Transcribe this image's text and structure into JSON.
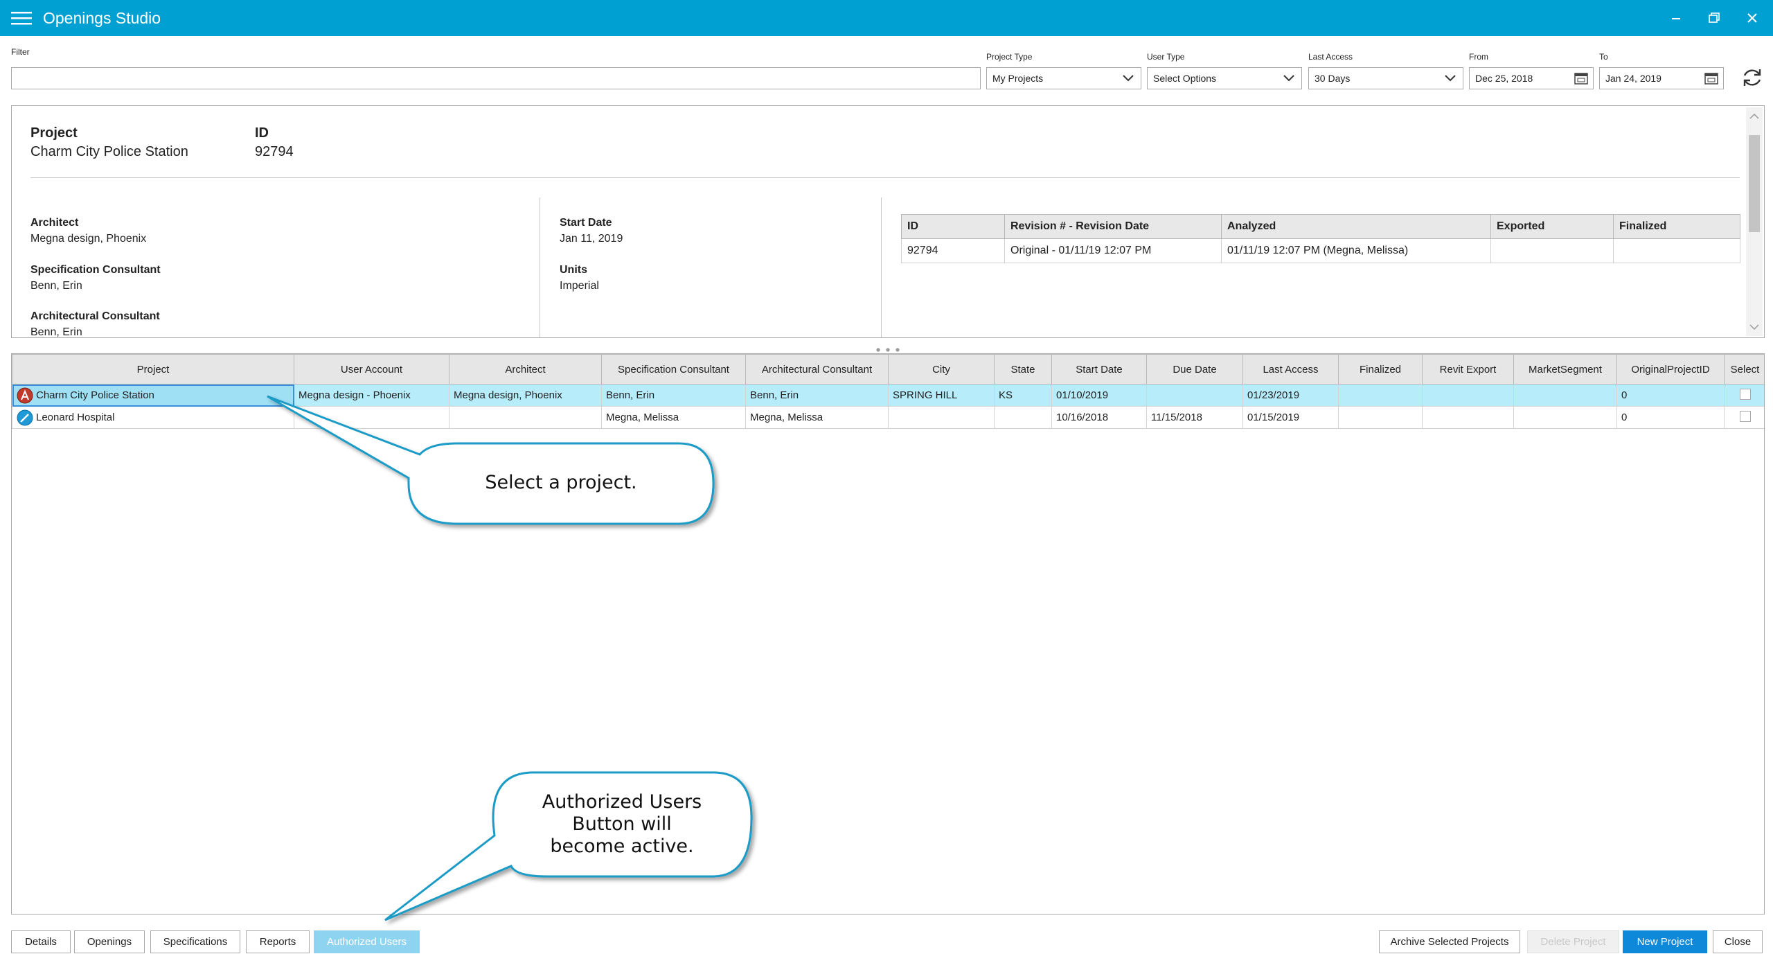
{
  "app": {
    "title": "Openings Studio"
  },
  "filters": {
    "filter_label": "Filter",
    "filter_value": "",
    "project_type": {
      "label": "Project Type",
      "value": "My Projects"
    },
    "user_type": {
      "label": "User Type",
      "value": "Select Options"
    },
    "last_access": {
      "label": "Last Access",
      "value": "30 Days"
    },
    "from": {
      "label": "From",
      "value": "Dec 25, 2018"
    },
    "to": {
      "label": "To",
      "value": "Jan 24, 2019"
    }
  },
  "details": {
    "project_label": "Project",
    "project_value": "Charm City Police Station",
    "id_label": "ID",
    "id_value": "92794",
    "architect_label": "Architect",
    "architect_value": "Megna design, Phoenix",
    "spec_label": "Specification Consultant",
    "spec_value": "Benn, Erin",
    "arch_consultant_label": "Architectural Consultant",
    "arch_consultant_value": "Benn, Erin",
    "start_label": "Start Date",
    "start_value": "Jan 11, 2019",
    "units_label": "Units",
    "units_value": "Imperial",
    "revisions": {
      "headers": [
        "ID",
        "Revision # - Revision Date",
        "Analyzed",
        "Exported",
        "Finalized"
      ],
      "rows": [
        [
          "92794",
          "Original - 01/11/19 12:07 PM",
          "01/11/19 12:07 PM (Megna, Melissa)",
          "",
          ""
        ]
      ]
    }
  },
  "grid": {
    "headers": [
      "Project",
      "User Account",
      "Architect",
      "Specification Consultant",
      "Architectural Consultant",
      "City",
      "State",
      "Start Date",
      "Due Date",
      "Last Access",
      "Finalized",
      "Revit Export",
      "MarketSegment",
      "OriginalProjectID",
      "Select"
    ],
    "rows": [
      [
        "Charm City Police Station",
        "Megna design - Phoenix",
        "Megna design, Phoenix",
        "Benn, Erin",
        "Benn, Erin",
        "SPRING HILL",
        "KS",
        "01/10/2019",
        "",
        "01/23/2019",
        "",
        "",
        "",
        "0",
        ""
      ],
      [
        "Leonard Hospital",
        "",
        "",
        "Megna, Melissa",
        "Megna, Melissa",
        "",
        "",
        "10/16/2018",
        "11/15/2018",
        "01/15/2019",
        "",
        "",
        "",
        "0",
        ""
      ]
    ],
    "selected_row": 0
  },
  "buttons": {
    "details": "Details",
    "openings": "Openings",
    "specifications": "Specifications",
    "reports": "Reports",
    "authorized_users": "Authorized Users",
    "archive": "Archive Selected Projects",
    "delete": "Delete Project",
    "new_project": "New Project",
    "close": "Close"
  },
  "callouts": {
    "select_project": "Select a project.",
    "authorized_line1": "Authorized Users",
    "authorized_line2": "Button will",
    "authorized_line3": "become active."
  },
  "colors": {
    "titlebar": "#00a0d2",
    "selected_row": "#b7ecfa",
    "primary_button": "#0e88d8",
    "active_button": "#8ed3ef",
    "callout_border": "#1a9bc7"
  }
}
